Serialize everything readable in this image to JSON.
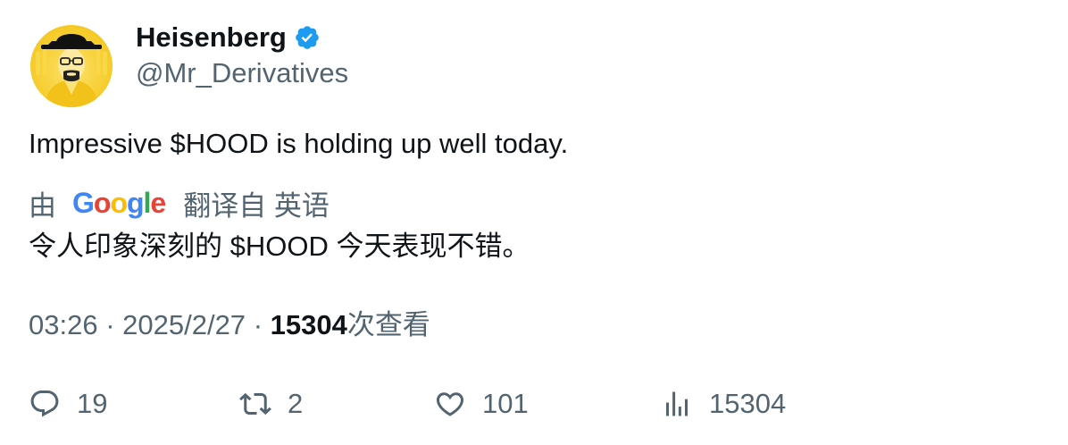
{
  "author": {
    "display_name": "Heisenberg",
    "handle": "@Mr_Derivatives",
    "verified": true,
    "verified_color": "#1d9bf0"
  },
  "tweet": {
    "text": "Impressive $HOOD is holding up well today."
  },
  "translation": {
    "prefix": "由",
    "provider": "Google",
    "suffix": "翻译自 英语",
    "text": "令人印象深刻的 $HOOD 今天表现不错。"
  },
  "meta": {
    "time": "03:26",
    "separator": "·",
    "date": "2025/2/27",
    "views_count": "15304",
    "views_label": "次查看"
  },
  "actions": {
    "replies": "19",
    "retweets": "2",
    "likes": "101",
    "views": "15304"
  },
  "icons": {
    "reply": "reply-icon",
    "retweet": "retweet-icon",
    "like": "heart-icon",
    "views": "analytics-icon",
    "verified": "verified-badge-icon"
  },
  "colors": {
    "text_primary": "#0f1419",
    "text_secondary": "#536471",
    "avatar_background": "#f6cf2e"
  }
}
